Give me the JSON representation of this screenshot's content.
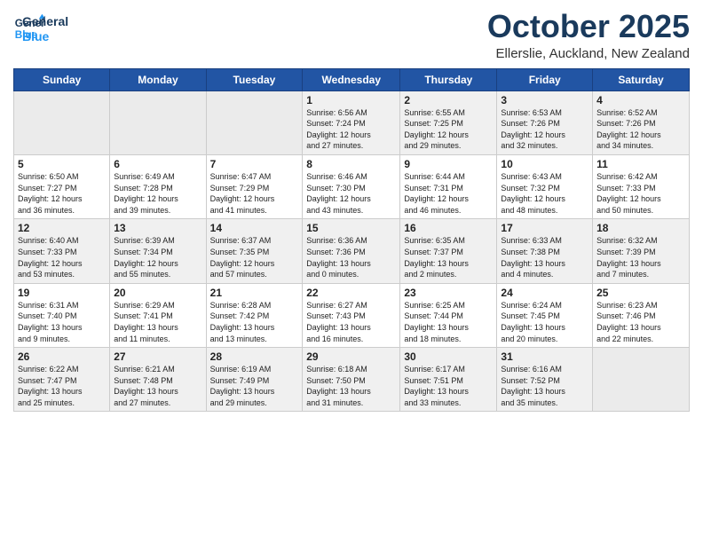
{
  "logo": {
    "line1": "General",
    "line2": "Blue"
  },
  "title": "October 2025",
  "location": "Ellerslie, Auckland, New Zealand",
  "weekdays": [
    "Sunday",
    "Monday",
    "Tuesday",
    "Wednesday",
    "Thursday",
    "Friday",
    "Saturday"
  ],
  "weeks": [
    [
      {
        "day": "",
        "info": ""
      },
      {
        "day": "",
        "info": ""
      },
      {
        "day": "",
        "info": ""
      },
      {
        "day": "1",
        "info": "Sunrise: 6:56 AM\nSunset: 7:24 PM\nDaylight: 12 hours\nand 27 minutes."
      },
      {
        "day": "2",
        "info": "Sunrise: 6:55 AM\nSunset: 7:25 PM\nDaylight: 12 hours\nand 29 minutes."
      },
      {
        "day": "3",
        "info": "Sunrise: 6:53 AM\nSunset: 7:26 PM\nDaylight: 12 hours\nand 32 minutes."
      },
      {
        "day": "4",
        "info": "Sunrise: 6:52 AM\nSunset: 7:26 PM\nDaylight: 12 hours\nand 34 minutes."
      }
    ],
    [
      {
        "day": "5",
        "info": "Sunrise: 6:50 AM\nSunset: 7:27 PM\nDaylight: 12 hours\nand 36 minutes."
      },
      {
        "day": "6",
        "info": "Sunrise: 6:49 AM\nSunset: 7:28 PM\nDaylight: 12 hours\nand 39 minutes."
      },
      {
        "day": "7",
        "info": "Sunrise: 6:47 AM\nSunset: 7:29 PM\nDaylight: 12 hours\nand 41 minutes."
      },
      {
        "day": "8",
        "info": "Sunrise: 6:46 AM\nSunset: 7:30 PM\nDaylight: 12 hours\nand 43 minutes."
      },
      {
        "day": "9",
        "info": "Sunrise: 6:44 AM\nSunset: 7:31 PM\nDaylight: 12 hours\nand 46 minutes."
      },
      {
        "day": "10",
        "info": "Sunrise: 6:43 AM\nSunset: 7:32 PM\nDaylight: 12 hours\nand 48 minutes."
      },
      {
        "day": "11",
        "info": "Sunrise: 6:42 AM\nSunset: 7:33 PM\nDaylight: 12 hours\nand 50 minutes."
      }
    ],
    [
      {
        "day": "12",
        "info": "Sunrise: 6:40 AM\nSunset: 7:33 PM\nDaylight: 12 hours\nand 53 minutes."
      },
      {
        "day": "13",
        "info": "Sunrise: 6:39 AM\nSunset: 7:34 PM\nDaylight: 12 hours\nand 55 minutes."
      },
      {
        "day": "14",
        "info": "Sunrise: 6:37 AM\nSunset: 7:35 PM\nDaylight: 12 hours\nand 57 minutes."
      },
      {
        "day": "15",
        "info": "Sunrise: 6:36 AM\nSunset: 7:36 PM\nDaylight: 13 hours\nand 0 minutes."
      },
      {
        "day": "16",
        "info": "Sunrise: 6:35 AM\nSunset: 7:37 PM\nDaylight: 13 hours\nand 2 minutes."
      },
      {
        "day": "17",
        "info": "Sunrise: 6:33 AM\nSunset: 7:38 PM\nDaylight: 13 hours\nand 4 minutes."
      },
      {
        "day": "18",
        "info": "Sunrise: 6:32 AM\nSunset: 7:39 PM\nDaylight: 13 hours\nand 7 minutes."
      }
    ],
    [
      {
        "day": "19",
        "info": "Sunrise: 6:31 AM\nSunset: 7:40 PM\nDaylight: 13 hours\nand 9 minutes."
      },
      {
        "day": "20",
        "info": "Sunrise: 6:29 AM\nSunset: 7:41 PM\nDaylight: 13 hours\nand 11 minutes."
      },
      {
        "day": "21",
        "info": "Sunrise: 6:28 AM\nSunset: 7:42 PM\nDaylight: 13 hours\nand 13 minutes."
      },
      {
        "day": "22",
        "info": "Sunrise: 6:27 AM\nSunset: 7:43 PM\nDaylight: 13 hours\nand 16 minutes."
      },
      {
        "day": "23",
        "info": "Sunrise: 6:25 AM\nSunset: 7:44 PM\nDaylight: 13 hours\nand 18 minutes."
      },
      {
        "day": "24",
        "info": "Sunrise: 6:24 AM\nSunset: 7:45 PM\nDaylight: 13 hours\nand 20 minutes."
      },
      {
        "day": "25",
        "info": "Sunrise: 6:23 AM\nSunset: 7:46 PM\nDaylight: 13 hours\nand 22 minutes."
      }
    ],
    [
      {
        "day": "26",
        "info": "Sunrise: 6:22 AM\nSunset: 7:47 PM\nDaylight: 13 hours\nand 25 minutes."
      },
      {
        "day": "27",
        "info": "Sunrise: 6:21 AM\nSunset: 7:48 PM\nDaylight: 13 hours\nand 27 minutes."
      },
      {
        "day": "28",
        "info": "Sunrise: 6:19 AM\nSunset: 7:49 PM\nDaylight: 13 hours\nand 29 minutes."
      },
      {
        "day": "29",
        "info": "Sunrise: 6:18 AM\nSunset: 7:50 PM\nDaylight: 13 hours\nand 31 minutes."
      },
      {
        "day": "30",
        "info": "Sunrise: 6:17 AM\nSunset: 7:51 PM\nDaylight: 13 hours\nand 33 minutes."
      },
      {
        "day": "31",
        "info": "Sunrise: 6:16 AM\nSunset: 7:52 PM\nDaylight: 13 hours\nand 35 minutes."
      },
      {
        "day": "",
        "info": ""
      }
    ]
  ]
}
